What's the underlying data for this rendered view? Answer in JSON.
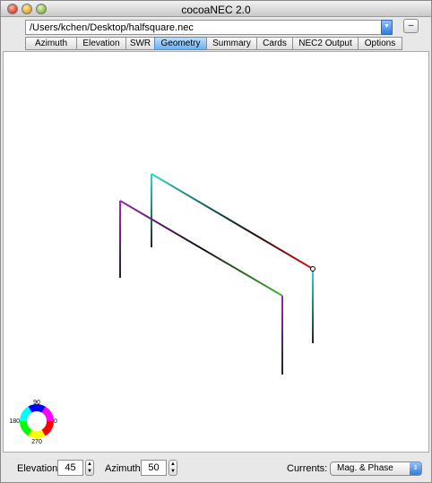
{
  "window": {
    "title": "cocoaNEC 2.0"
  },
  "path": {
    "value": "/Users/kchen/Desktop/halfsquare.nec",
    "collapse_label": "–"
  },
  "tabs": [
    {
      "label": "Azimuth",
      "active": false
    },
    {
      "label": "Elevation",
      "active": false
    },
    {
      "label": "SWR",
      "active": false
    },
    {
      "label": "Geometry",
      "active": true
    },
    {
      "label": "Summary",
      "active": false
    },
    {
      "label": "Cards",
      "active": false
    },
    {
      "label": "NEC2 Output",
      "active": false
    },
    {
      "label": "Options",
      "active": false
    }
  ],
  "phase_wheel": {
    "top": "90",
    "left": "180",
    "right": "0",
    "bottom": "270"
  },
  "controls": {
    "elevation_label": "Elevation",
    "elevation_value": "45",
    "azimuth_label": "Azimuth",
    "azimuth_value": "50",
    "currents_label": "Currents:",
    "currents_value": "Mag. & Phase"
  },
  "colors": {
    "active_tab": "#6ab0f2",
    "wire_cyan": "#27dcd4",
    "wire_purple": "#9a2bb0",
    "wire_green": "#44b832",
    "wire_red": "#c8102e"
  }
}
